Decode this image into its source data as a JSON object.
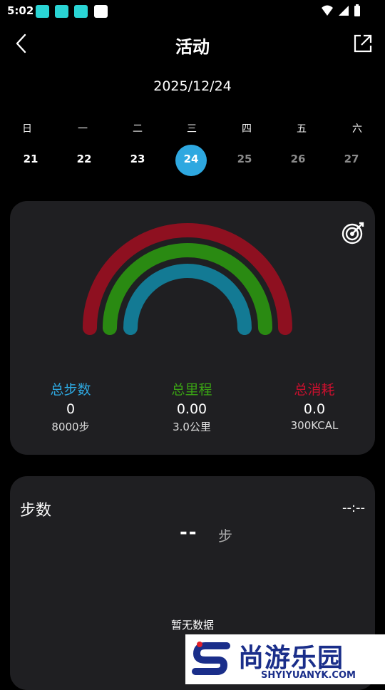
{
  "status_bar": {
    "time": "5:02"
  },
  "app_bar": {
    "title": "活动"
  },
  "date": "2025/12/24",
  "week": {
    "day_labels": [
      "日",
      "一",
      "二",
      "三",
      "四",
      "五",
      "六"
    ],
    "dates": [
      "21",
      "22",
      "23",
      "24",
      "25",
      "26",
      "27"
    ],
    "selected_index": 3
  },
  "summary": {
    "steps": {
      "label": "总步数",
      "value": "0",
      "goal": "8000步",
      "color": "#2ea8e0"
    },
    "distance": {
      "label": "总里程",
      "value": "0.00",
      "goal": "3.0公里",
      "color": "#3aa214"
    },
    "calories": {
      "label": "总消耗",
      "value": "0.0",
      "goal": "300KCAL",
      "color": "#c8102e"
    }
  },
  "steps_card": {
    "title": "步数",
    "time": "--:--",
    "value": "--",
    "unit": "步",
    "empty_text": "暂无数据"
  },
  "watermark": {
    "text": "尚游乐园",
    "url": "SHYIYUANYK.COM"
  }
}
